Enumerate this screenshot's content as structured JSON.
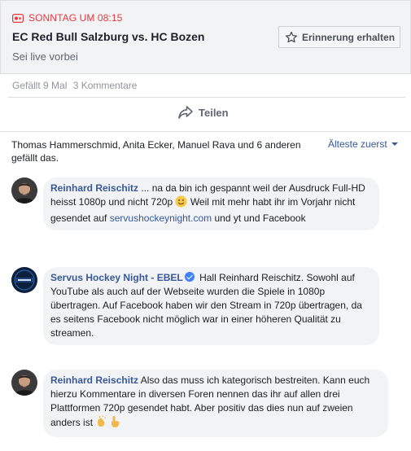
{
  "event": {
    "time": "SONNTAG UM 08:15",
    "title": "EC Red Bull Salzburg vs. HC Bozen",
    "subtitle": "Sei live vorbei",
    "remind_label": "Erinnerung erhalten"
  },
  "stats": {
    "likes": "Gefällt 9 Mal",
    "comments": "3 Kommentare"
  },
  "share_label": "Teilen",
  "likers_text": "Thomas Hammerschmid, Anita Ecker, Manuel Rava und 6 anderen gefällt das.",
  "sort_label": "Älteste zuerst",
  "comments": [
    {
      "author": "Reinhard Reischitz",
      "text_1": "... na da bin ich gespannt weil der Ausdruck Full-HD heisst 1080p und nicht 720p",
      "text_2": "Weil mit mehr habt ihr im Vorjahr nicht gesendet auf",
      "link": "servushockeynight.com",
      "text_3": "und yt und Facebook"
    },
    {
      "author": "Servus Hockey Night - EBEL",
      "text": "Hall Reinhard Reischitz. Sowohl auf YouTube als auch auf der Webseite wurden die Spiele in 1080p übertragen. Auf Facebook haben wir den Stream in 720p übertragen, da es seitens Facebook nicht möglich war in einer höheren Qualität zu streamen."
    },
    {
      "author": "Reinhard Reischitz",
      "text": "Also das muss ich kategorisch bestreiten. Kann euch hierzu Kommentare in diversen Foren nennen das ihr auf allen drei Plattformen 720p gesendet habt. Aber positiv das dies nun auf zweien anders ist"
    }
  ],
  "colors": {
    "live_red": "#e9373f",
    "link_blue": "#385898",
    "bubble_bg": "#f2f3f5",
    "verified_blue": "#4080ff"
  },
  "icons": [
    "live-video-icon",
    "star-icon",
    "share-arrow-icon",
    "verified-badge-icon",
    "smile-emoji",
    "clapping-hands-emoji",
    "pointing-hand-emoji"
  ]
}
